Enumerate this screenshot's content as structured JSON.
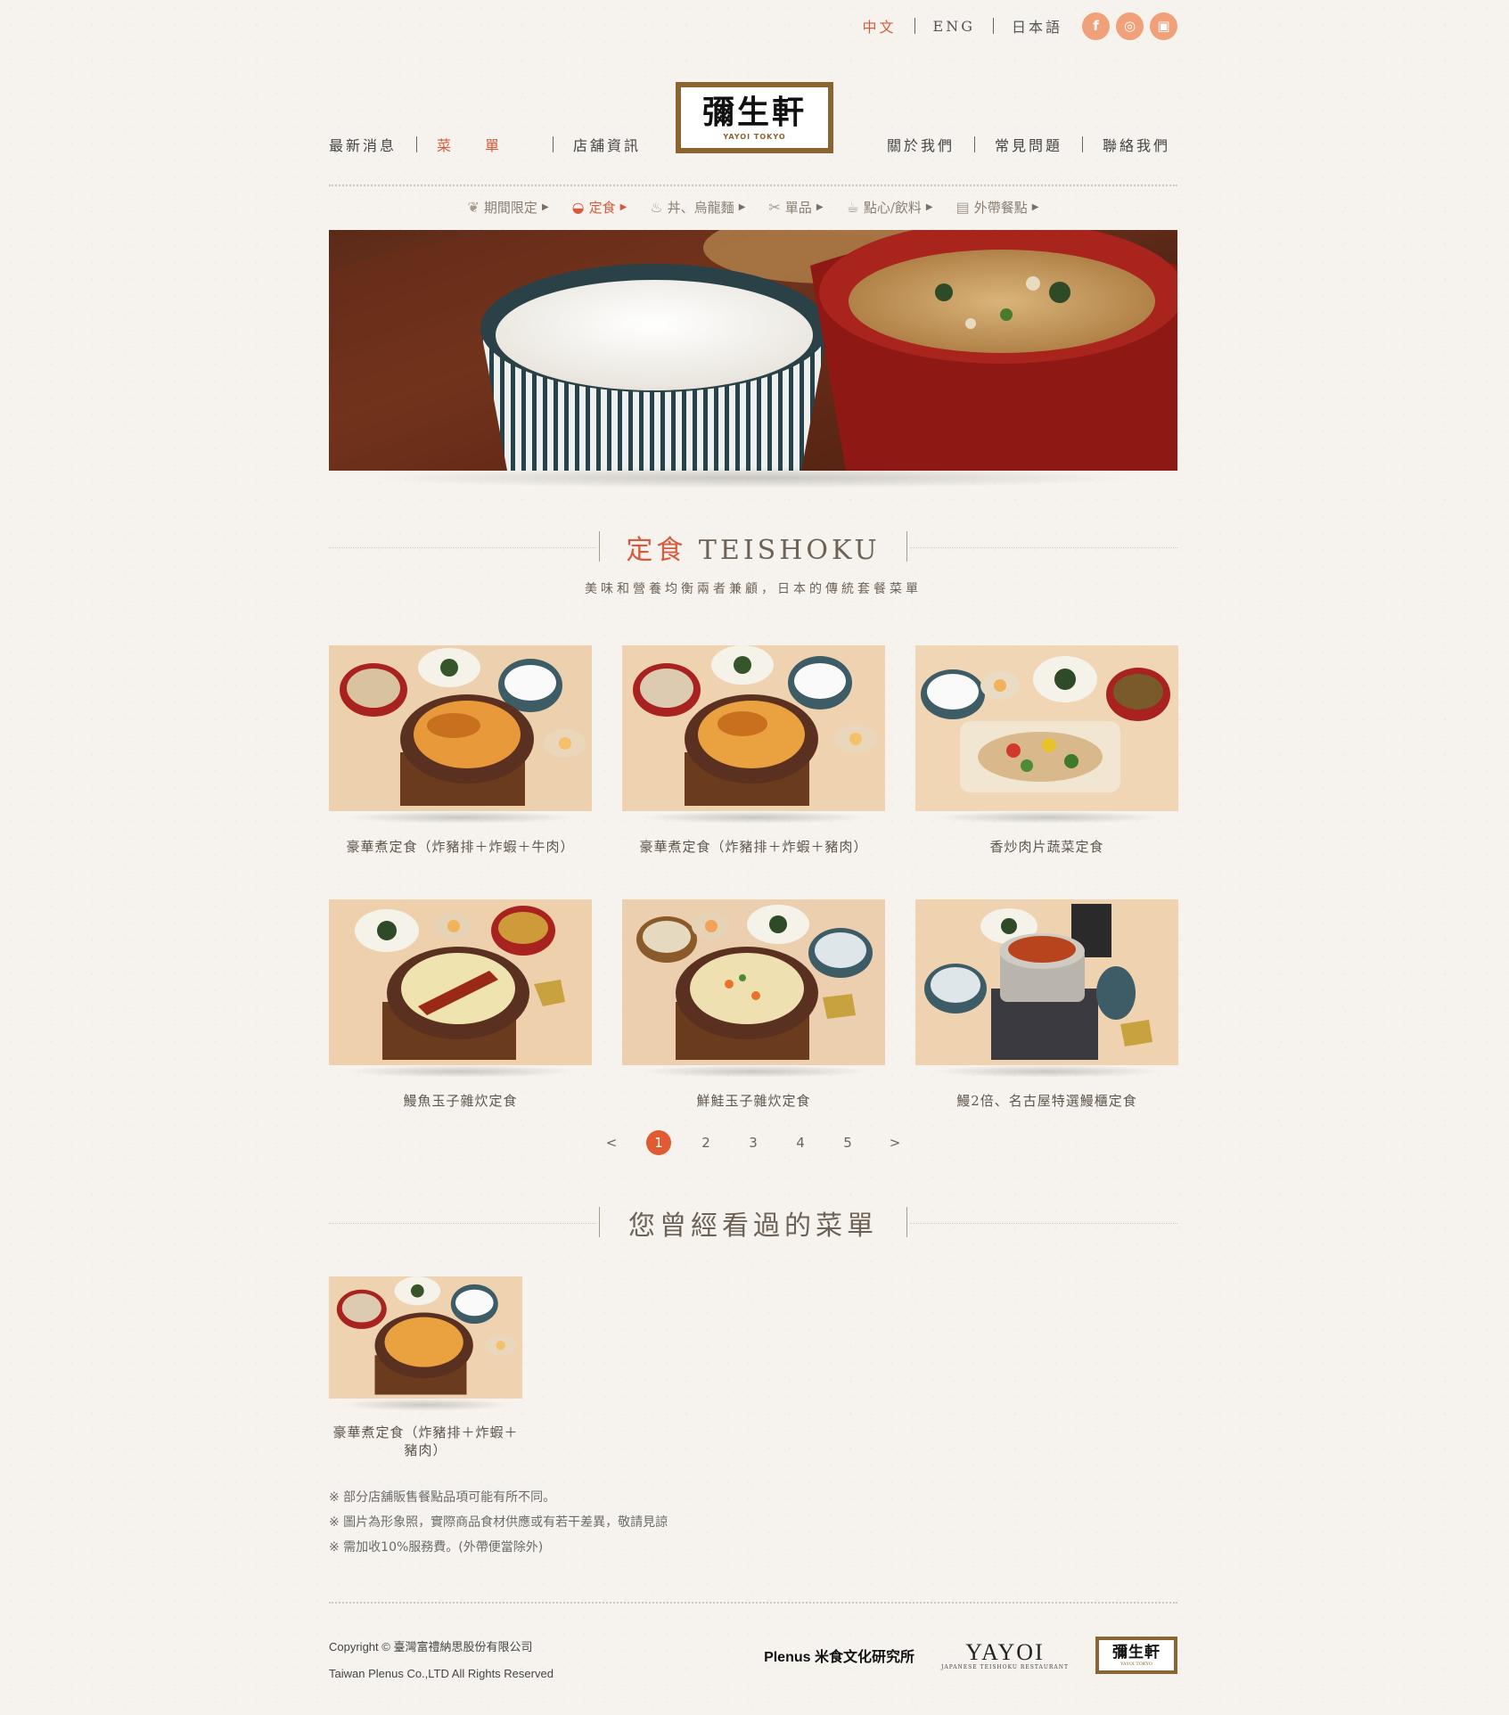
{
  "languages": [
    "中文",
    "ENG",
    "日本語"
  ],
  "social": [
    {
      "icon": "facebook-icon",
      "glyph": "f"
    },
    {
      "icon": "instagram-icon",
      "glyph": "◎"
    },
    {
      "icon": "shop-bag-icon",
      "glyph": "▣"
    }
  ],
  "logo": {
    "main": "彌生軒",
    "sub": "YAYOI TOKYO"
  },
  "nav": {
    "left": [
      "最新消息",
      "菜單",
      "店舖資訊"
    ],
    "right": [
      "關於我們",
      "常見問題",
      "聯絡我們"
    ]
  },
  "categories": [
    {
      "label": "期間限定",
      "icon": "leaf-icon",
      "glyph": "❦"
    },
    {
      "label": "定食",
      "icon": "bowl-icon",
      "glyph": "◒"
    },
    {
      "label": "丼、烏龍麵",
      "icon": "noodle-bowl-icon",
      "glyph": "♨"
    },
    {
      "label": "單品",
      "icon": "utensils-icon",
      "glyph": "✂"
    },
    {
      "label": "點心/飲料",
      "icon": "dessert-icon",
      "glyph": "☕"
    },
    {
      "label": "外帶餐點",
      "icon": "takeout-box-icon",
      "glyph": "▤"
    }
  ],
  "section": {
    "title_zh": "定食",
    "title_en": "TEISHOKU",
    "subtitle": "美味和營養均衡兩者兼顧，日本的傳統套餐菜單"
  },
  "menu_items": [
    "豪華煮定食（炸豬排＋炸蝦＋牛肉）",
    "豪華煮定食（炸豬排＋炸蝦＋豬肉）",
    "香炒肉片蔬菜定食",
    "鰻魚玉子雜炊定食",
    "鮮鮭玉子雜炊定食",
    "鰻2倍、名古屋特選鰻櫃定食"
  ],
  "pagination": {
    "prev": "<",
    "pages": [
      "1",
      "2",
      "3",
      "4",
      "5"
    ],
    "current": "1",
    "next": ">"
  },
  "viewed": {
    "title": "您曾經看過的菜單",
    "items": [
      "豪華煮定食（炸豬排＋炸蝦＋豬肉）"
    ]
  },
  "notes": [
    "※ 部分店舖販售餐點品項可能有所不同。",
    "※ 圖片為形象照，實際商品食材供應或有若干差異，敬請見諒",
    "※ 需加收10%服務費。(外帶便當除外)"
  ],
  "footer": {
    "copyright": "Copyright © 臺灣富禮納思股份有限公司",
    "rights": "Taiwan Plenus Co.,LTD All Rights Reserved",
    "plenus": "Plenus 米食文化研究所",
    "yayoi": "YAYOI",
    "yayoi_sub": "JAPANESE TEISHOKU RESTAURANT",
    "logo_main": "彌生軒"
  },
  "colors": {
    "accent": "#d65a3c",
    "logo_frame": "#8a6431",
    "background": "#f6f3ee"
  }
}
